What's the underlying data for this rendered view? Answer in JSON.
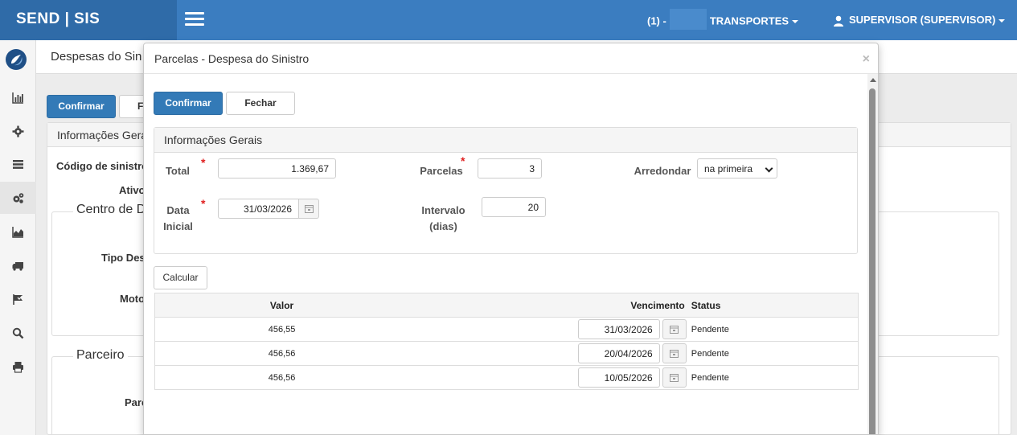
{
  "app": {
    "brand": "SEND | SIS",
    "company_prefix": "(1) -",
    "company_name": "TRANSPORTES",
    "user": "SUPERVISOR (SUPERVISOR)"
  },
  "sidebar": {
    "items": [
      {
        "icon": "bar-chart-icon"
      },
      {
        "icon": "gear-icon"
      },
      {
        "icon": "list-icon"
      },
      {
        "icon": "gears-icon"
      },
      {
        "icon": "area-chart-icon"
      },
      {
        "icon": "truck-icon"
      },
      {
        "icon": "flag-icon"
      },
      {
        "icon": "search-icon"
      },
      {
        "icon": "print-icon"
      }
    ]
  },
  "background": {
    "page_title": "Despesas do Sin",
    "confirm_label": "Confirmar",
    "close_label": "F",
    "panel_title": "Informações Gera",
    "codigo_label": "Código de sinistro",
    "ativo_label": "Ativo",
    "centro_legend": "Centro de D",
    "tipo_label": "Tipo Des",
    "motivo_label": "Moto",
    "parceiro_legend": "Parceiro",
    "parc_label": "Parc"
  },
  "modal": {
    "title": "Parcelas - Despesa do Sinistro",
    "close_symbol": "×",
    "confirm_label": "Confirmar",
    "close_label": "Fechar",
    "panel_title": "Informações Gerais",
    "fields": {
      "total_label": "Total",
      "total_value": "1.369,67",
      "parcelas_label": "Parcelas",
      "parcelas_value": "3",
      "arredondar_label": "Arredondar",
      "arredondar_value": "na primeira",
      "data_inicial_label_1": "Data",
      "data_inicial_label_2": "Inicial",
      "data_inicial_value": "31/03/2026",
      "intervalo_label_1": "Intervalo",
      "intervalo_label_2": "(dias)",
      "intervalo_value": "20",
      "required_marker": "*"
    },
    "calcular_label": "Calcular",
    "table": {
      "headers": {
        "valor": "Valor",
        "vencimento": "Vencimento",
        "status": "Status"
      },
      "rows": [
        {
          "valor": "456,55",
          "vencimento": "31/03/2026",
          "status": "Pendente"
        },
        {
          "valor": "456,56",
          "vencimento": "20/04/2026",
          "status": "Pendente"
        },
        {
          "valor": "456,56",
          "vencimento": "10/05/2026",
          "status": "Pendente"
        }
      ]
    }
  },
  "colors": {
    "topbar": "#3b7dc0",
    "brand_bg": "#2f6ba8",
    "primary": "#337ab7",
    "required": "#e02020"
  }
}
